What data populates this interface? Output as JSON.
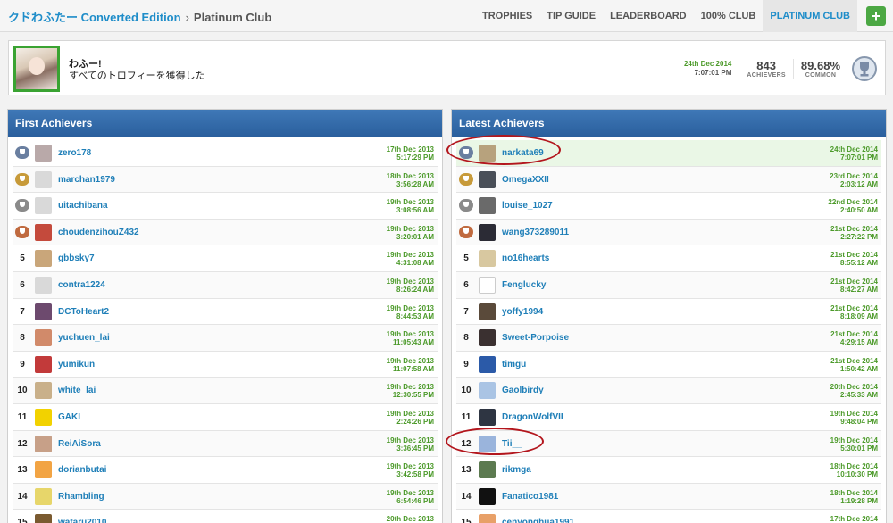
{
  "breadcrumb": {
    "game": "クドわふたー Converted Edition",
    "sep": "›",
    "page": "Platinum Club"
  },
  "nav": [
    "TROPHIES",
    "TIP GUIDE",
    "LEADERBOARD",
    "100% CLUB",
    "PLATINUM CLUB"
  ],
  "nav_active": "PLATINUM CLUB",
  "add_label": "+",
  "trophy": {
    "title": "わふー!",
    "description": "すべてのトロフィーを獲得した",
    "date": "24th Dec 2014",
    "time": "7:07:01 PM",
    "achievers": "843",
    "achievers_label": "ACHIEVERS",
    "common": "89.68%",
    "common_label": "COMMON",
    "icon": "platinum-trophy-icon"
  },
  "first": {
    "title": "First Achievers",
    "rows": [
      {
        "rank": "",
        "cup": "plat",
        "name": "zero178",
        "date": "17th Dec 2013",
        "time": "5:17:29 PM"
      },
      {
        "rank": "",
        "cup": "gold",
        "name": "marchan1979",
        "date": "18th Dec 2013",
        "time": "3:56:28 AM"
      },
      {
        "rank": "",
        "cup": "silver",
        "name": "uitachibana",
        "date": "19th Dec 2013",
        "time": "3:08:56 AM"
      },
      {
        "rank": "",
        "cup": "bronze",
        "name": "choudenzihouZ432",
        "date": "19th Dec 2013",
        "time": "3:20:01 AM"
      },
      {
        "rank": "5",
        "cup": "",
        "name": "gbbsky7",
        "date": "19th Dec 2013",
        "time": "4:31:08 AM"
      },
      {
        "rank": "6",
        "cup": "",
        "name": "contra1224",
        "date": "19th Dec 2013",
        "time": "8:26:24 AM"
      },
      {
        "rank": "7",
        "cup": "",
        "name": "DCToHeart2",
        "date": "19th Dec 2013",
        "time": "8:44:53 AM"
      },
      {
        "rank": "8",
        "cup": "",
        "name": "yuchuen_lai",
        "date": "19th Dec 2013",
        "time": "11:05:43 AM"
      },
      {
        "rank": "9",
        "cup": "",
        "name": "yumikun",
        "date": "19th Dec 2013",
        "time": "11:07:58 AM"
      },
      {
        "rank": "10",
        "cup": "",
        "name": "white_lai",
        "date": "19th Dec 2013",
        "time": "12:30:55 PM"
      },
      {
        "rank": "11",
        "cup": "",
        "name": "GAKI",
        "date": "19th Dec 2013",
        "time": "2:24:26 PM"
      },
      {
        "rank": "12",
        "cup": "",
        "name": "ReiAiSora",
        "date": "19th Dec 2013",
        "time": "3:36:45 PM"
      },
      {
        "rank": "13",
        "cup": "",
        "name": "dorianbutai",
        "date": "19th Dec 2013",
        "time": "3:42:58 PM"
      },
      {
        "rank": "14",
        "cup": "",
        "name": "Rhambling",
        "date": "19th Dec 2013",
        "time": "6:54:46 PM"
      },
      {
        "rank": "15",
        "cup": "",
        "name": "wataru2010",
        "date": "20th Dec 2013",
        "time": ""
      }
    ]
  },
  "latest": {
    "title": "Latest Achievers",
    "rows": [
      {
        "rank": "",
        "cup": "plat",
        "name": "narkata69",
        "date": "24th Dec 2014",
        "time": "7:07:01 PM"
      },
      {
        "rank": "",
        "cup": "gold",
        "name": "OmegaXXII",
        "date": "23rd Dec 2014",
        "time": "2:03:12 AM"
      },
      {
        "rank": "",
        "cup": "silver",
        "name": "louise_1027",
        "date": "22nd Dec 2014",
        "time": "2:40:50 AM"
      },
      {
        "rank": "",
        "cup": "bronze",
        "name": "wang373289011",
        "date": "21st Dec 2014",
        "time": "2:27:22 PM"
      },
      {
        "rank": "5",
        "cup": "",
        "name": "no16hearts",
        "date": "21st Dec 2014",
        "time": "8:55:12 AM"
      },
      {
        "rank": "6",
        "cup": "",
        "name": "Fenglucky",
        "date": "21st Dec 2014",
        "time": "8:42:27 AM"
      },
      {
        "rank": "7",
        "cup": "",
        "name": "yoffy1994",
        "date": "21st Dec 2014",
        "time": "8:18:09 AM"
      },
      {
        "rank": "8",
        "cup": "",
        "name": "Sweet-Porpoise",
        "date": "21st Dec 2014",
        "time": "4:29:15 AM"
      },
      {
        "rank": "9",
        "cup": "",
        "name": "timgu",
        "date": "21st Dec 2014",
        "time": "1:50:42 AM"
      },
      {
        "rank": "10",
        "cup": "",
        "name": "Gaolbirdy",
        "date": "20th Dec 2014",
        "time": "2:45:33 AM"
      },
      {
        "rank": "11",
        "cup": "",
        "name": "DragonWolfVII",
        "date": "19th Dec 2014",
        "time": "9:48:04 PM"
      },
      {
        "rank": "12",
        "cup": "",
        "name": "Tii__",
        "date": "19th Dec 2014",
        "time": "5:30:01 PM"
      },
      {
        "rank": "13",
        "cup": "",
        "name": "rikmga",
        "date": "18th Dec 2014",
        "time": "10:10:30 PM"
      },
      {
        "rank": "14",
        "cup": "",
        "name": "Fanatico1981",
        "date": "18th Dec 2014",
        "time": "1:19:28 PM"
      },
      {
        "rank": "15",
        "cup": "",
        "name": "cenyonghua1991",
        "date": "17th Dec 2014",
        "time": ""
      }
    ]
  },
  "avatar_colors": {
    "first": [
      "#b9a9a9",
      "",
      "",
      "#c44a3c",
      "#c9a67a",
      "",
      "#6d4a6e",
      "#d18a6a",
      "#c23a3a",
      "#c9b08a",
      "#f2d200",
      "#c7a088",
      "#f2a444",
      "#e7d66a",
      "#7a5a30"
    ],
    "latest": [
      "#b7a27d",
      "#4a4f58",
      "#6a6a6a",
      "#2b2b35",
      "#d8c8a0",
      "#ffffff",
      "#5a4a3a",
      "#3a3030",
      "#2b5aa8",
      "#aac4e4",
      "#2e3542",
      "#9ab4dc",
      "#5c7a50",
      "#111111",
      "#e8a068"
    ]
  },
  "accent": "#1f8dc9",
  "date_color": "#4c9a2a"
}
